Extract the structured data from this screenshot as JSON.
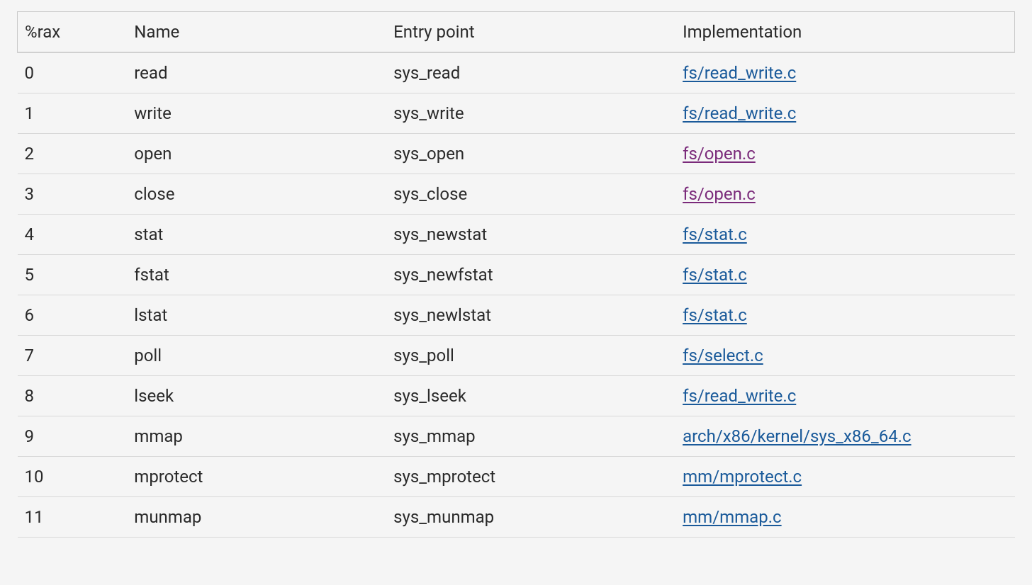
{
  "table": {
    "headers": {
      "rax": "%rax",
      "name": "Name",
      "entry": "Entry point",
      "impl": "Implementation"
    },
    "rows": [
      {
        "rax": "0",
        "name": "read",
        "entry": "sys_read",
        "impl": "fs/read_write.c",
        "visited": false
      },
      {
        "rax": "1",
        "name": "write",
        "entry": "sys_write",
        "impl": "fs/read_write.c",
        "visited": false
      },
      {
        "rax": "2",
        "name": "open",
        "entry": "sys_open",
        "impl": "fs/open.c",
        "visited": true
      },
      {
        "rax": "3",
        "name": "close",
        "entry": "sys_close",
        "impl": "fs/open.c",
        "visited": true
      },
      {
        "rax": "4",
        "name": "stat",
        "entry": "sys_newstat",
        "impl": "fs/stat.c",
        "visited": false
      },
      {
        "rax": "5",
        "name": "fstat",
        "entry": "sys_newfstat",
        "impl": "fs/stat.c",
        "visited": false
      },
      {
        "rax": "6",
        "name": "lstat",
        "entry": "sys_newlstat",
        "impl": "fs/stat.c",
        "visited": false
      },
      {
        "rax": "7",
        "name": "poll",
        "entry": "sys_poll",
        "impl": "fs/select.c",
        "visited": false
      },
      {
        "rax": "8",
        "name": "lseek",
        "entry": "sys_lseek",
        "impl": "fs/read_write.c",
        "visited": false
      },
      {
        "rax": "9",
        "name": "mmap",
        "entry": "sys_mmap",
        "impl": "arch/x86/kernel/sys_x86_64.c",
        "visited": false
      },
      {
        "rax": "10",
        "name": "mprotect",
        "entry": "sys_mprotect",
        "impl": "mm/mprotect.c",
        "visited": false
      },
      {
        "rax": "11",
        "name": "munmap",
        "entry": "sys_munmap",
        "impl": "mm/mmap.c",
        "visited": false
      }
    ]
  }
}
